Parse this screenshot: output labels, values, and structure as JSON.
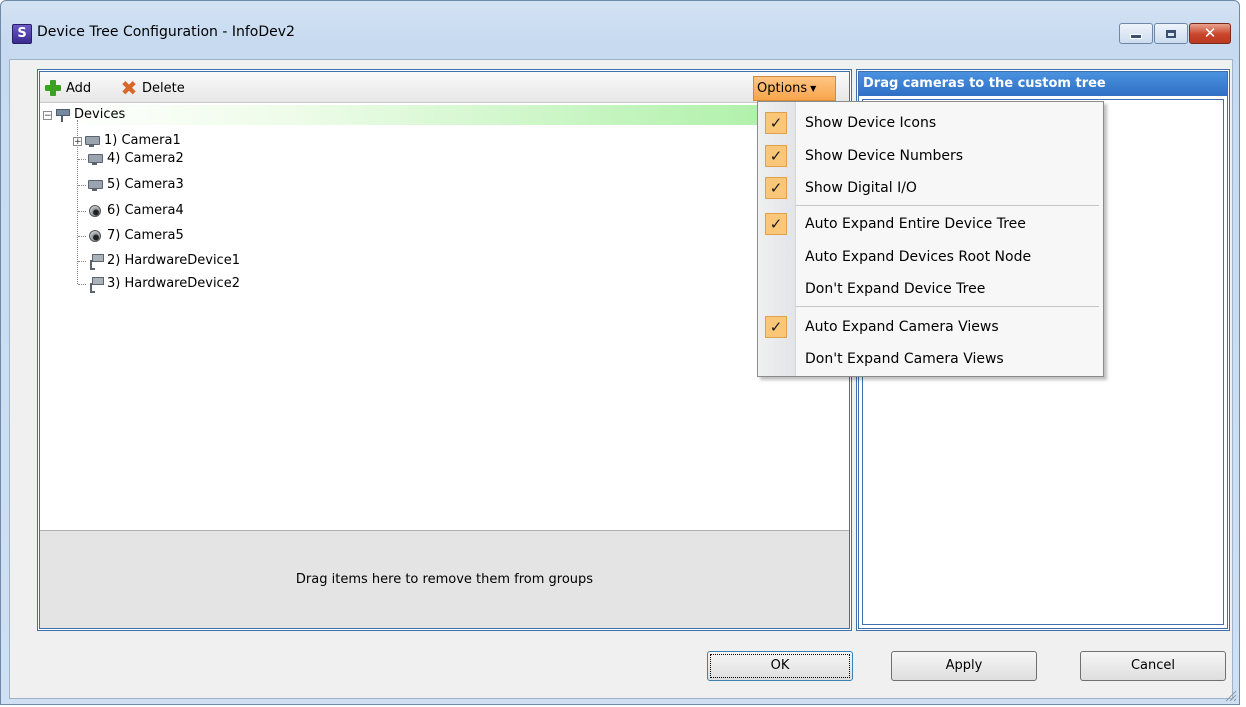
{
  "window": {
    "title": "Device Tree Configuration - InfoDev2",
    "app_icon_letter": "S"
  },
  "toolbar": {
    "add_label": "Add",
    "delete_label": "Delete",
    "options_label": "Options"
  },
  "tree": {
    "root_label": "Devices",
    "items": [
      {
        "label": "1) Camera1",
        "icon": "camera-icon"
      },
      {
        "label": "4) Camera2",
        "icon": "camera-icon"
      },
      {
        "label": "5) Camera3",
        "icon": "camera-icon"
      },
      {
        "label": "6) Camera4",
        "icon": "dome-camera-icon"
      },
      {
        "label": "7) Camera5",
        "icon": "dome-camera-icon"
      },
      {
        "label": "2) HardwareDevice1",
        "icon": "hardware-device-icon"
      },
      {
        "label": "3) HardwareDevice2",
        "icon": "hardware-device-icon"
      }
    ]
  },
  "drop_area": {
    "text": "Drag items here to remove them from groups"
  },
  "custom_tree": {
    "header": "Drag cameras to the custom tree"
  },
  "options_menu": {
    "items": [
      {
        "label": "Show Device Icons",
        "checked": true
      },
      {
        "label": "Show Device Numbers",
        "checked": true
      },
      {
        "label": "Show Digital I/O",
        "checked": true
      },
      {
        "label": "Auto Expand Entire Device Tree",
        "checked": true
      },
      {
        "label": "Auto Expand Devices Root Node",
        "checked": false
      },
      {
        "label": "Don't Expand Device Tree",
        "checked": false
      },
      {
        "label": "Auto Expand Camera Views",
        "checked": true
      },
      {
        "label": "Don't Expand Camera Views",
        "checked": false
      }
    ],
    "check_glyph": "✓"
  },
  "buttons": {
    "ok": "OK",
    "apply": "Apply",
    "cancel": "Cancel"
  }
}
